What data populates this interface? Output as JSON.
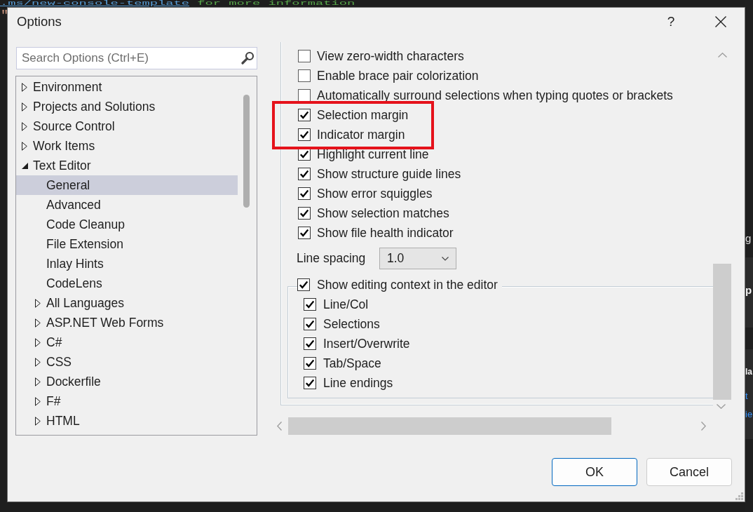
{
  "background": {
    "code_lines": [
      [
        {
          "kind": "link",
          "text": ".ms/new-console-template"
        },
        {
          "kind": "comment",
          "text": " for more information"
        }
      ],
      [
        {
          "kind": "string",
          "text": "\""
        }
      ]
    ],
    "side_panels": [
      {
        "fragments": [
          {
            "kind": "text",
            "text": "g"
          }
        ]
      },
      {
        "fragments": [
          {
            "kind": "heading",
            "text": "p"
          }
        ]
      },
      {
        "fragments": [
          {
            "kind": "heading",
            "text": "la"
          },
          {
            "kind": "link",
            "text": "t"
          },
          {
            "kind": "link",
            "text": "ie"
          }
        ]
      }
    ]
  },
  "window": {
    "title": "Options",
    "help": "?"
  },
  "search": {
    "placeholder": "Search Options (Ctrl+E)"
  },
  "tree": [
    {
      "label": "Environment",
      "kind": "folder",
      "expanded": false,
      "selected": false
    },
    {
      "label": "Projects and Solutions",
      "kind": "folder",
      "expanded": false,
      "selected": false
    },
    {
      "label": "Source Control",
      "kind": "folder",
      "expanded": false,
      "selected": false
    },
    {
      "label": "Work Items",
      "kind": "folder",
      "expanded": false,
      "selected": false
    },
    {
      "label": "Text Editor",
      "kind": "folder",
      "expanded": true,
      "selected": false,
      "children": [
        {
          "label": "General",
          "kind": "leaf",
          "selected": true
        },
        {
          "label": "Advanced",
          "kind": "leaf",
          "selected": false
        },
        {
          "label": "Code Cleanup",
          "kind": "leaf",
          "selected": false
        },
        {
          "label": "File Extension",
          "kind": "leaf",
          "selected": false
        },
        {
          "label": "Inlay Hints",
          "kind": "leaf",
          "selected": false
        },
        {
          "label": "CodeLens",
          "kind": "leaf",
          "selected": false
        },
        {
          "label": "All Languages",
          "kind": "folder",
          "expanded": false,
          "selected": false
        },
        {
          "label": "ASP.NET Web Forms",
          "kind": "folder",
          "expanded": false,
          "selected": false
        },
        {
          "label": "C#",
          "kind": "folder",
          "expanded": false,
          "selected": false
        },
        {
          "label": "CSS",
          "kind": "folder",
          "expanded": false,
          "selected": false
        },
        {
          "label": "Dockerfile",
          "kind": "folder",
          "expanded": false,
          "selected": false
        },
        {
          "label": "F#",
          "kind": "folder",
          "expanded": false,
          "selected": false
        },
        {
          "label": "HTML",
          "kind": "folder",
          "expanded": false,
          "selected": false
        }
      ]
    }
  ],
  "options": [
    {
      "label": "View zero-width characters",
      "checked": false
    },
    {
      "label": "Enable brace pair colorization",
      "checked": false
    },
    {
      "label": "Automatically surround selections when typing quotes or brackets",
      "checked": false
    },
    {
      "label": "Selection margin",
      "checked": true
    },
    {
      "label": "Indicator margin",
      "checked": true
    },
    {
      "label": "Highlight current line",
      "checked": true
    },
    {
      "label": "Show structure guide lines",
      "checked": true
    },
    {
      "label": "Show error squiggles",
      "checked": true
    },
    {
      "label": "Show selection matches",
      "checked": true
    },
    {
      "label": "Show file health indicator",
      "checked": true
    }
  ],
  "line_spacing": {
    "label": "Line spacing",
    "value": "1.0"
  },
  "editing_context": {
    "label": "Show editing context in the editor",
    "checked": true,
    "items": [
      {
        "label": "Line/Col",
        "checked": true
      },
      {
        "label": "Selections",
        "checked": true
      },
      {
        "label": "Insert/Overwrite",
        "checked": true
      },
      {
        "label": "Tab/Space",
        "checked": true
      },
      {
        "label": "Line endings",
        "checked": true
      }
    ]
  },
  "buttons": [
    {
      "label": "OK",
      "default": true
    },
    {
      "label": "Cancel",
      "default": false
    }
  ]
}
